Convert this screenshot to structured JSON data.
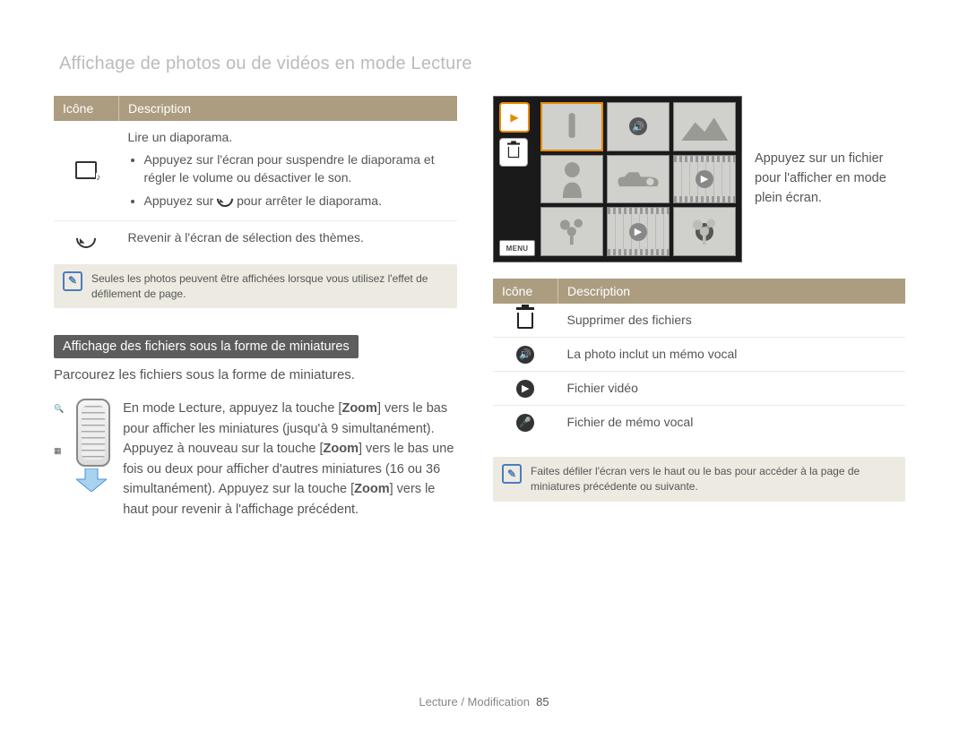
{
  "page_title": "Affichage de photos ou de vidéos en mode Lecture",
  "table_left": {
    "header_icon": "Icône",
    "header_desc": "Description",
    "row1": {
      "label": "Lire un diaporama.",
      "bullet1a": "Appuyez sur l'écran pour suspendre le diaporama et régler le volume ou désactiver le son.",
      "bullet2a": "Appuyez sur ",
      "bullet2b": " pour arrêter le diaporama."
    },
    "row2": "Revenir à l'écran de sélection des thèmes."
  },
  "note_left": "Seules les photos peuvent être affichées lorsque vous utilisez l'effet de défilement de page.",
  "section_bar": "Affichage des fichiers sous la forme de miniatures",
  "section_desc": "Parcourez les fichiers sous la forme de miniatures.",
  "zoom_text_html": "En mode Lecture, appuyez la touche [<b>Zoom</b>] vers le bas pour afficher les miniatures (jusqu'à 9 simultanément). Appuyez à nouveau sur la touche [<b>Zoom</b>] vers le bas une fois ou deux pour afficher d'autres miniatures (16 ou 36 simultanément). Appuyez sur la touche [<b>Zoom</b>] vers le haut pour revenir à l'affichage précédent.",
  "shot": {
    "caption": "Appuyez sur un fichier pour l'afficher en mode plein écran.",
    "menu_label": "MENU"
  },
  "table_right": {
    "header_icon": "Icône",
    "header_desc": "Description",
    "r1": "Supprimer des fichiers",
    "r2": "La photo inclut un mémo vocal",
    "r3": "Fichier vidéo",
    "r4": "Fichier de mémo vocal"
  },
  "note_right": "Faites défiler l'écran vers le haut ou le bas pour accéder à la page de miniatures précédente ou suivante.",
  "footer_section": "Lecture / Modification",
  "footer_page": "85"
}
